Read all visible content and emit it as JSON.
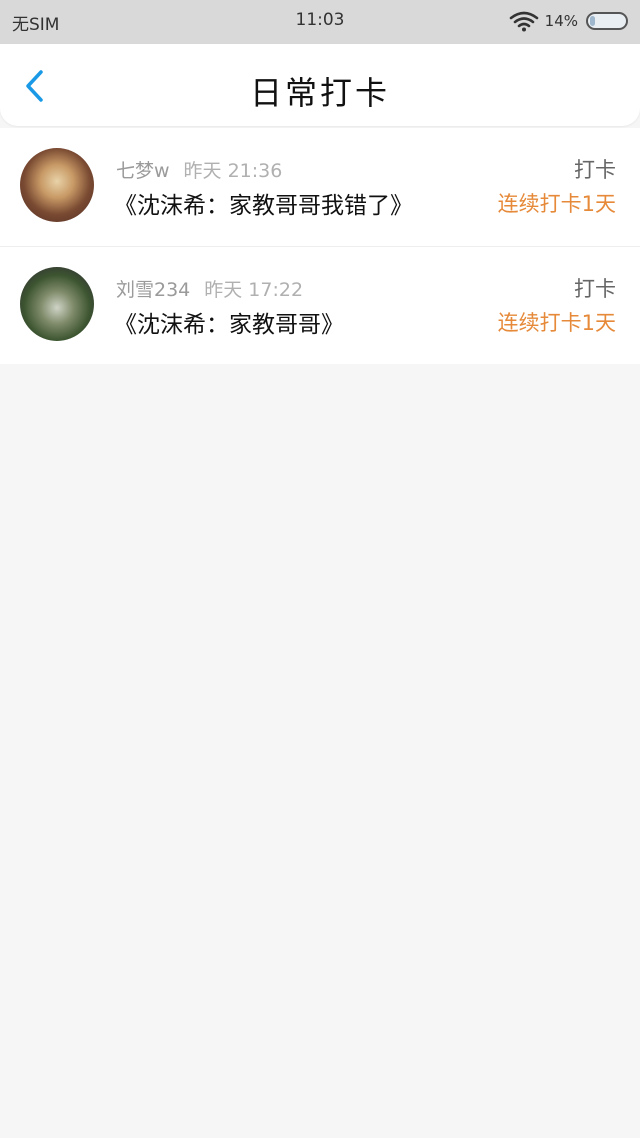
{
  "status_bar": {
    "carrier": "无SIM",
    "time": "11:03",
    "battery_percent": "14%",
    "battery_level": 0.14
  },
  "nav": {
    "title": "日常打卡",
    "accent_color": "#1a9ae6"
  },
  "items": [
    {
      "username": "七梦w",
      "time": "昨天 21:36",
      "book": "《沈沫希：家教哥哥我错了》",
      "action": "打卡",
      "streak": "连续打卡1天"
    },
    {
      "username": "刘雪234",
      "time": "昨天 17:22",
      "book": "《沈沫希：家教哥哥》",
      "action": "打卡",
      "streak": "连续打卡1天"
    }
  ],
  "colors": {
    "streak": "#e68a3a",
    "background": "#f6f6f6"
  }
}
